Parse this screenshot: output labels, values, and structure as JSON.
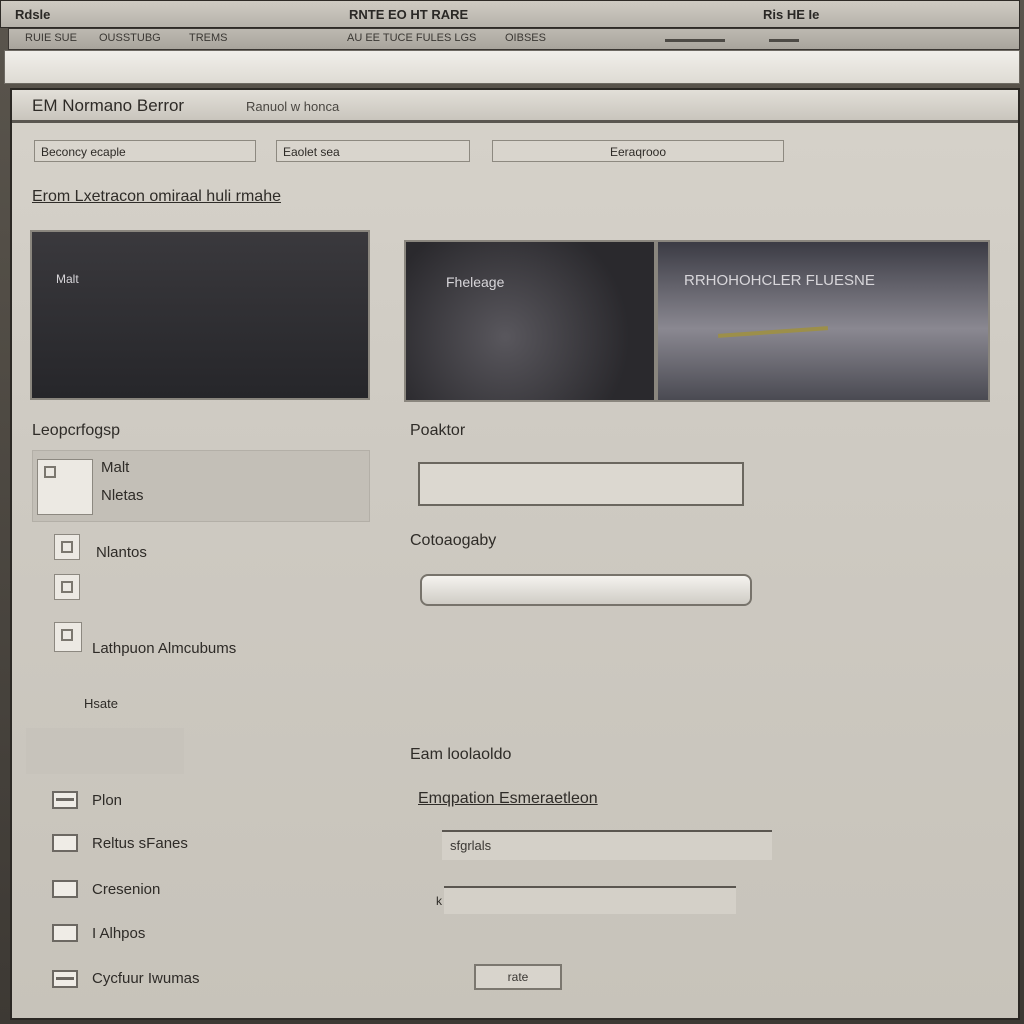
{
  "menubar": {
    "left": "Rdsle",
    "center": "RNTE EO HT RARE",
    "right": "Ris HE Ie"
  },
  "toolbar": {
    "item1": "RUIE SUE",
    "item2": "OUSSTUBG",
    "item3": "TREMS",
    "item4": "AU EE TUCE FULES LGS",
    "item5": "OIBSES"
  },
  "window": {
    "title": "EM Normano Berror",
    "subtitle": "Ranuol w honca",
    "fields": [
      "Beconcy ecaple",
      "Eaolet sea",
      "Eeraqrooo"
    ],
    "section_heading": "Erom Lxetracon omiraal huli rmahe",
    "panels": [
      {
        "caption": "Malt"
      },
      {
        "caption": "Fheleage"
      },
      {
        "caption": "RRHOHOHCLER FLUESNE"
      }
    ],
    "left": {
      "heading": "Leopcrfogsp",
      "items": [
        {
          "icon": "document-icon",
          "line1": "Malt",
          "line2": "Nletas"
        },
        {
          "icon": "document-icon",
          "line1": "Nlantos"
        },
        {
          "icon": "document-icon"
        },
        {
          "icon": "printer-icon",
          "line1": "Lathpuon Almcubums"
        }
      ],
      "note": "Hsate",
      "checks": [
        {
          "label": "Plon",
          "checked": true
        },
        {
          "label": "Reltus sFanes",
          "checked": false
        },
        {
          "label": "Cresenion",
          "checked": false
        },
        {
          "label": "I Alhpos",
          "checked": false
        },
        {
          "label": "Cycfuur Iwumas",
          "checked": true
        }
      ]
    },
    "right": {
      "label1": "Poaktor",
      "label2": "Cotoaogaby",
      "section2": "Eam loolaoldo",
      "link": "Emqpation Esmeraetleon",
      "text1": "sfgrlals",
      "text2": "k",
      "button": "rate"
    }
  }
}
